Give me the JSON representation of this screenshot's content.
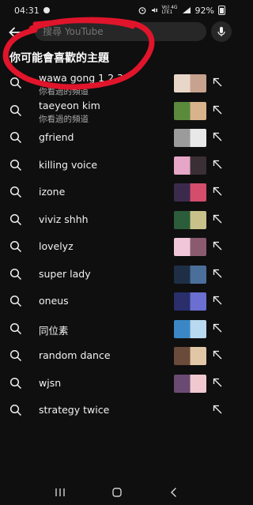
{
  "status_bar": {
    "time": "04:31",
    "signal_text": "Vo) 4G\nLTE1",
    "battery": "92%"
  },
  "search": {
    "placeholder": "搜尋 YouTube"
  },
  "section_title": "你可能會喜歡的主題",
  "suggestions": [
    {
      "label": "wawa gong 1 2 3",
      "sub": "你看過的頻道",
      "thumb": [
        "#e8d7c9",
        "#c7a28f"
      ]
    },
    {
      "label": "taeyeon kim",
      "sub": "你看過的頻道",
      "thumb": [
        "#5b8a3c",
        "#d9b38c"
      ]
    },
    {
      "label": "gfriend",
      "thumb": [
        "#9b9b9b",
        "#e8e8e8"
      ]
    },
    {
      "label": "killing voice",
      "thumb": [
        "#e6a6c7",
        "#3a2f34"
      ]
    },
    {
      "label": "izone",
      "thumb": [
        "#3c2a4d",
        "#d44d6b"
      ]
    },
    {
      "label": "viviz shhh",
      "thumb": [
        "#2b5d3a",
        "#c8c28a"
      ]
    },
    {
      "label": "lovelyz",
      "thumb": [
        "#f0c6d8",
        "#8a5a6e"
      ]
    },
    {
      "label": "super lady",
      "thumb": [
        "#1e2f45",
        "#4a6f9a"
      ]
    },
    {
      "label": "oneus",
      "thumb": [
        "#2a2f6b",
        "#6a6fd1"
      ]
    },
    {
      "label": "同位素",
      "thumb": [
        "#3b87c6",
        "#b8d9ef"
      ]
    },
    {
      "label": "random dance",
      "thumb": [
        "#6a4a3a",
        "#e2c7a6"
      ]
    },
    {
      "label": "wjsn",
      "thumb": [
        "#6a4a72",
        "#f0c8d0"
      ]
    },
    {
      "label": "strategy twice"
    }
  ],
  "colors": {
    "background": "#0f0f0f",
    "field": "#272727",
    "annotation": "#e0152b"
  }
}
